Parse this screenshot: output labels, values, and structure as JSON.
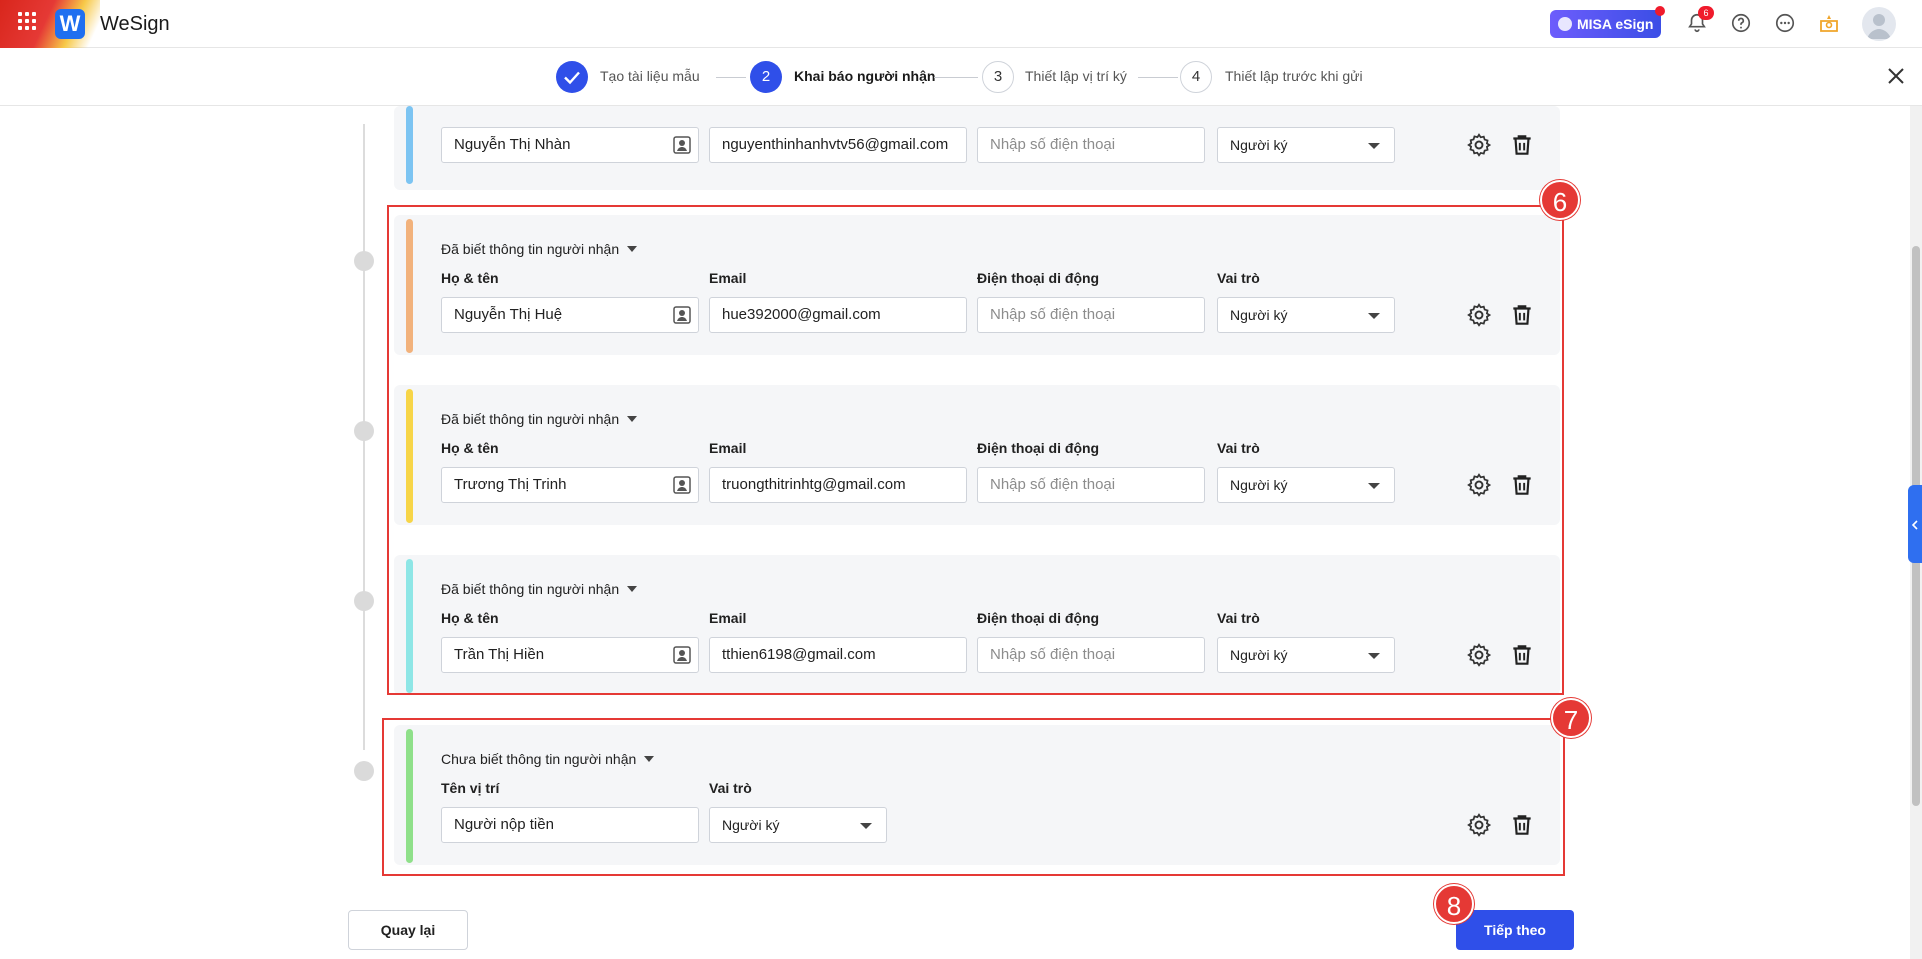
{
  "header": {
    "app_name": "WeSign",
    "logo_letter": "W",
    "misa_label": "MISA eSign",
    "notification_count": "6"
  },
  "stepper": {
    "steps": [
      {
        "number": "1",
        "label": "Tạo tài liệu mẫu",
        "state": "done"
      },
      {
        "number": "2",
        "label": "Khai báo người nhận",
        "state": "active"
      },
      {
        "number": "3",
        "label": "Thiết lập vị trí ký",
        "state": "idle"
      },
      {
        "number": "4",
        "label": "Thiết lập trước khi gửi",
        "state": "idle"
      }
    ]
  },
  "labels": {
    "known_info": "Đã biết thông tin người nhận",
    "unknown_info": "Chưa biết thông tin người nhận",
    "full_name": "Họ & tên",
    "email": "Email",
    "mobile": "Điện thoại di động",
    "role": "Vai trò",
    "position_name": "Tên vị trí",
    "phone_placeholder": "Nhập số điện thoại"
  },
  "recipients": [
    {
      "name": "Nguyễn Thị Nhàn",
      "email": "nguyenthinhanhvtv56@gmail.com",
      "phone": "",
      "role": "Người ký",
      "color": "#7cc4f2"
    },
    {
      "name": "Nguyễn Thị Huệ",
      "email": "hue392000@gmail.com",
      "phone": "",
      "role": "Người ký",
      "color": "#f2b27c"
    },
    {
      "name": "Trương Thị Trinh",
      "email": "truongthitrinhtg@gmail.com",
      "phone": "",
      "role": "Người ký",
      "color": "#f7d548"
    },
    {
      "name": "Trần Thị Hiền",
      "email": "tthien6198@gmail.com",
      "phone": "",
      "role": "Người ký",
      "color": "#8ee6e6"
    }
  ],
  "unknown_recipient": {
    "position": "Người nộp tiền",
    "role": "Người ký",
    "color": "#8fe08a"
  },
  "annotations": {
    "box6": "6",
    "box7": "7",
    "badge8": "8"
  },
  "footer": {
    "back_label": "Quay lại",
    "next_label": "Tiếp theo"
  },
  "colors": {
    "primary": "#2f4fe9",
    "highlight": "#e53935"
  }
}
